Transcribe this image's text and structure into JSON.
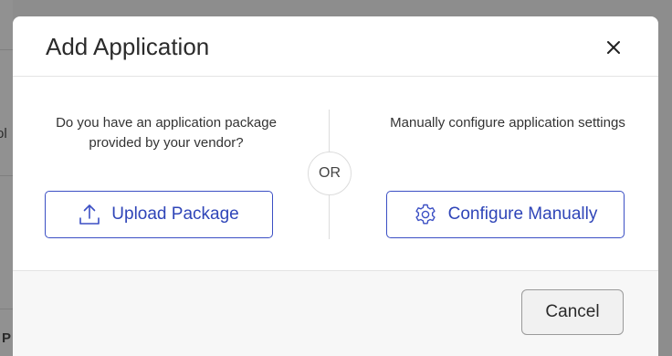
{
  "background": {
    "fragment_top": "ol",
    "fragment_bottom": "P"
  },
  "dialog": {
    "title": "Add Application",
    "close_icon": "close-icon",
    "left": {
      "prompt": "Do you have an application package provided by your vendor?",
      "button_label": "Upload Package",
      "button_icon": "upload-icon"
    },
    "separator": "OR",
    "right": {
      "prompt": "Manually configure application settings",
      "button_label": "Configure Manually",
      "button_icon": "gear-icon"
    },
    "footer": {
      "cancel_label": "Cancel"
    }
  },
  "colors": {
    "accent": "#3b4fc4",
    "overlay": "#8d8d8d"
  }
}
